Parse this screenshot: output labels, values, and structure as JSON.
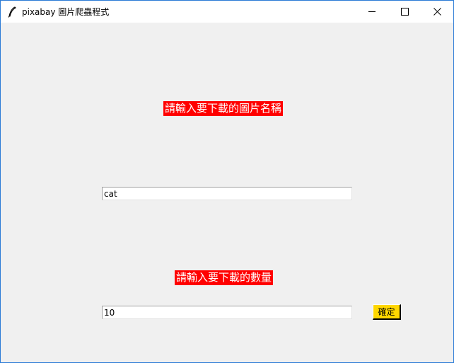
{
  "window": {
    "title": "pixabay 圖片爬蟲程式",
    "icon": "feather-icon",
    "controls": [
      "minimize-icon",
      "maximize-icon",
      "close-icon"
    ]
  },
  "form": {
    "name_label": "請輸入要下載的圖片名稱",
    "name_value": "cat",
    "count_label": "請輸入要下載的數量",
    "count_value": "10",
    "confirm_label": "確定"
  },
  "colors": {
    "label_background": "#ff0000",
    "label_text": "#ffffff",
    "button_background": "#ffd700",
    "window_background": "#f0f0f0"
  }
}
